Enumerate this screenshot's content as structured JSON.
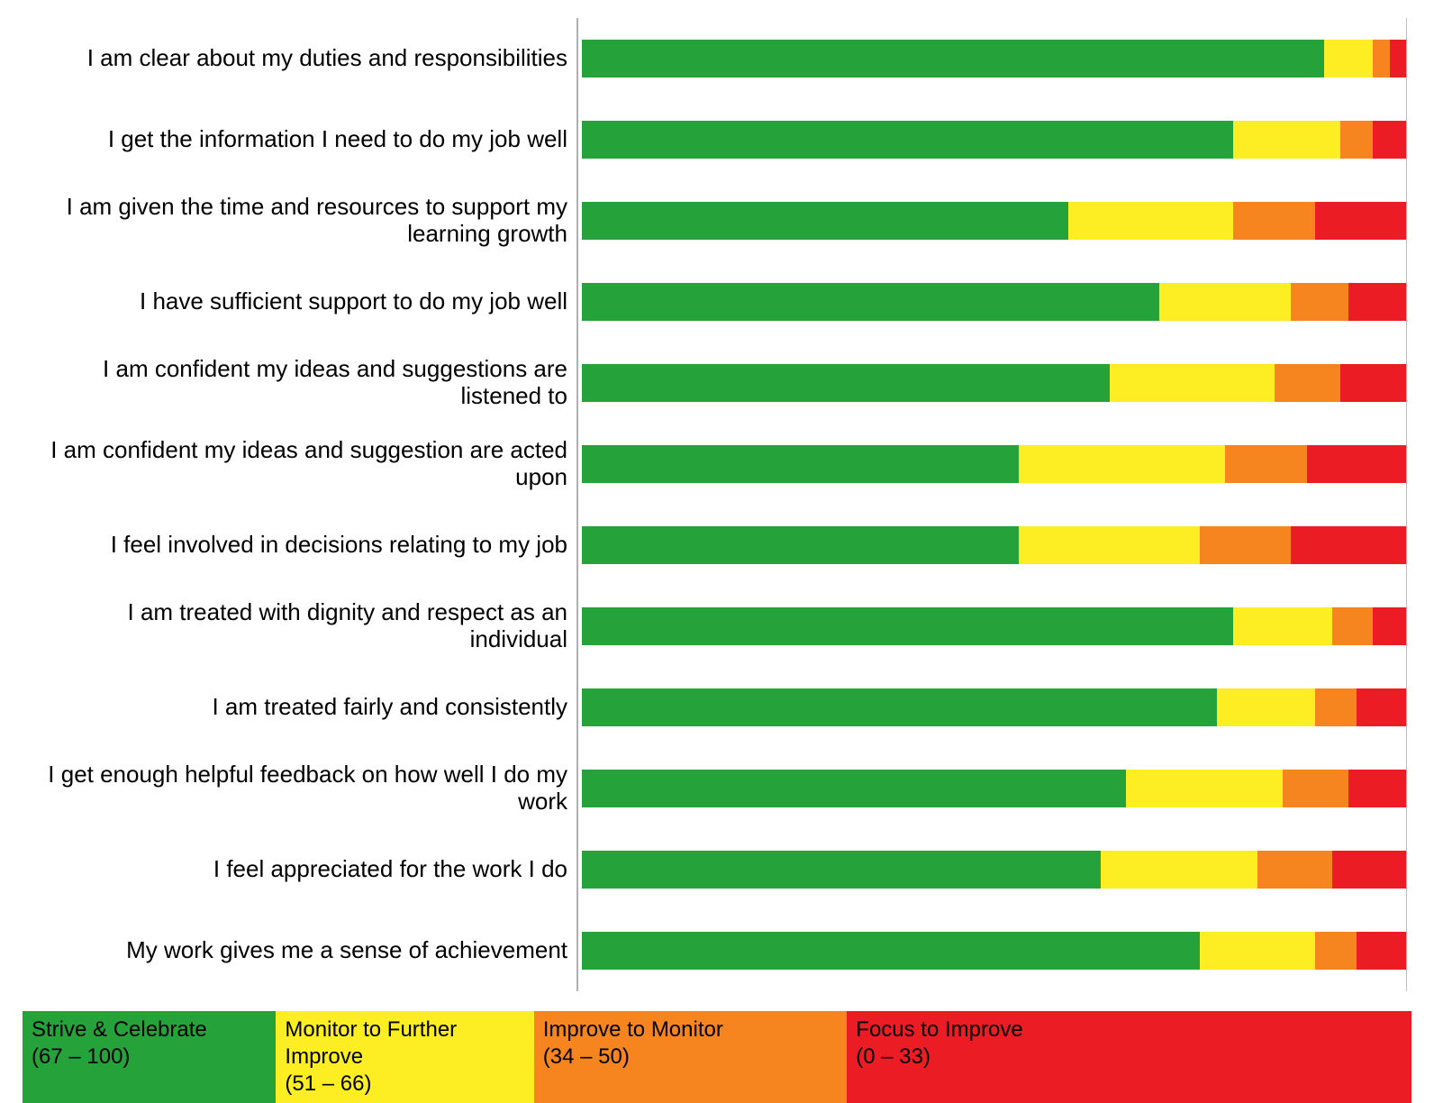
{
  "chart_data": {
    "type": "bar",
    "orientation": "horizontal",
    "stacked": true,
    "xlim": [
      0,
      100
    ],
    "categories": [
      "I am clear about my duties and responsibilities",
      "I get the information I need to do my job well",
      "I am given the time and resources to support my learning growth",
      "I have sufficient support to do my job well",
      "I am confident my ideas and suggestions are listened to",
      "I am confident my ideas and suggestion are acted upon",
      "I feel involved in decisions relating to my job",
      "I am treated with dignity and respect as an individual",
      "I am treated fairly and consistently",
      "I get enough helpful feedback on how well I do my work",
      "I feel appreciated for the work I do",
      "My work gives me a sense of achievement"
    ],
    "series": [
      {
        "name": "Strive & Celebrate (67 – 100)",
        "color": "#26a23a",
        "values": [
          90,
          79,
          59,
          70,
          64,
          53,
          53,
          79,
          77,
          66,
          63,
          75
        ]
      },
      {
        "name": "Monitor to Further Improve (51 – 66)",
        "color": "#fcee23",
        "values": [
          6,
          13,
          20,
          16,
          20,
          25,
          22,
          12,
          12,
          19,
          19,
          14
        ]
      },
      {
        "name": "Improve to Monitor (34 – 50)",
        "color": "#f6851f",
        "values": [
          2,
          4,
          10,
          7,
          8,
          10,
          11,
          5,
          5,
          8,
          9,
          5
        ]
      },
      {
        "name": "Focus to Improve (0 – 33)",
        "color": "#ec1c24",
        "values": [
          2,
          4,
          11,
          7,
          8,
          12,
          14,
          4,
          6,
          7,
          9,
          6
        ]
      }
    ]
  },
  "legend": {
    "items": [
      {
        "title": "Strive & Celebrate",
        "range": "(67 – 100)"
      },
      {
        "title": "Monitor to Further Improve",
        "range": "(51 – 66)"
      },
      {
        "title": "Improve to Monitor",
        "range": "(34 – 50)"
      },
      {
        "title": "Focus to Improve",
        "range": "(0 – 33)"
      }
    ]
  }
}
